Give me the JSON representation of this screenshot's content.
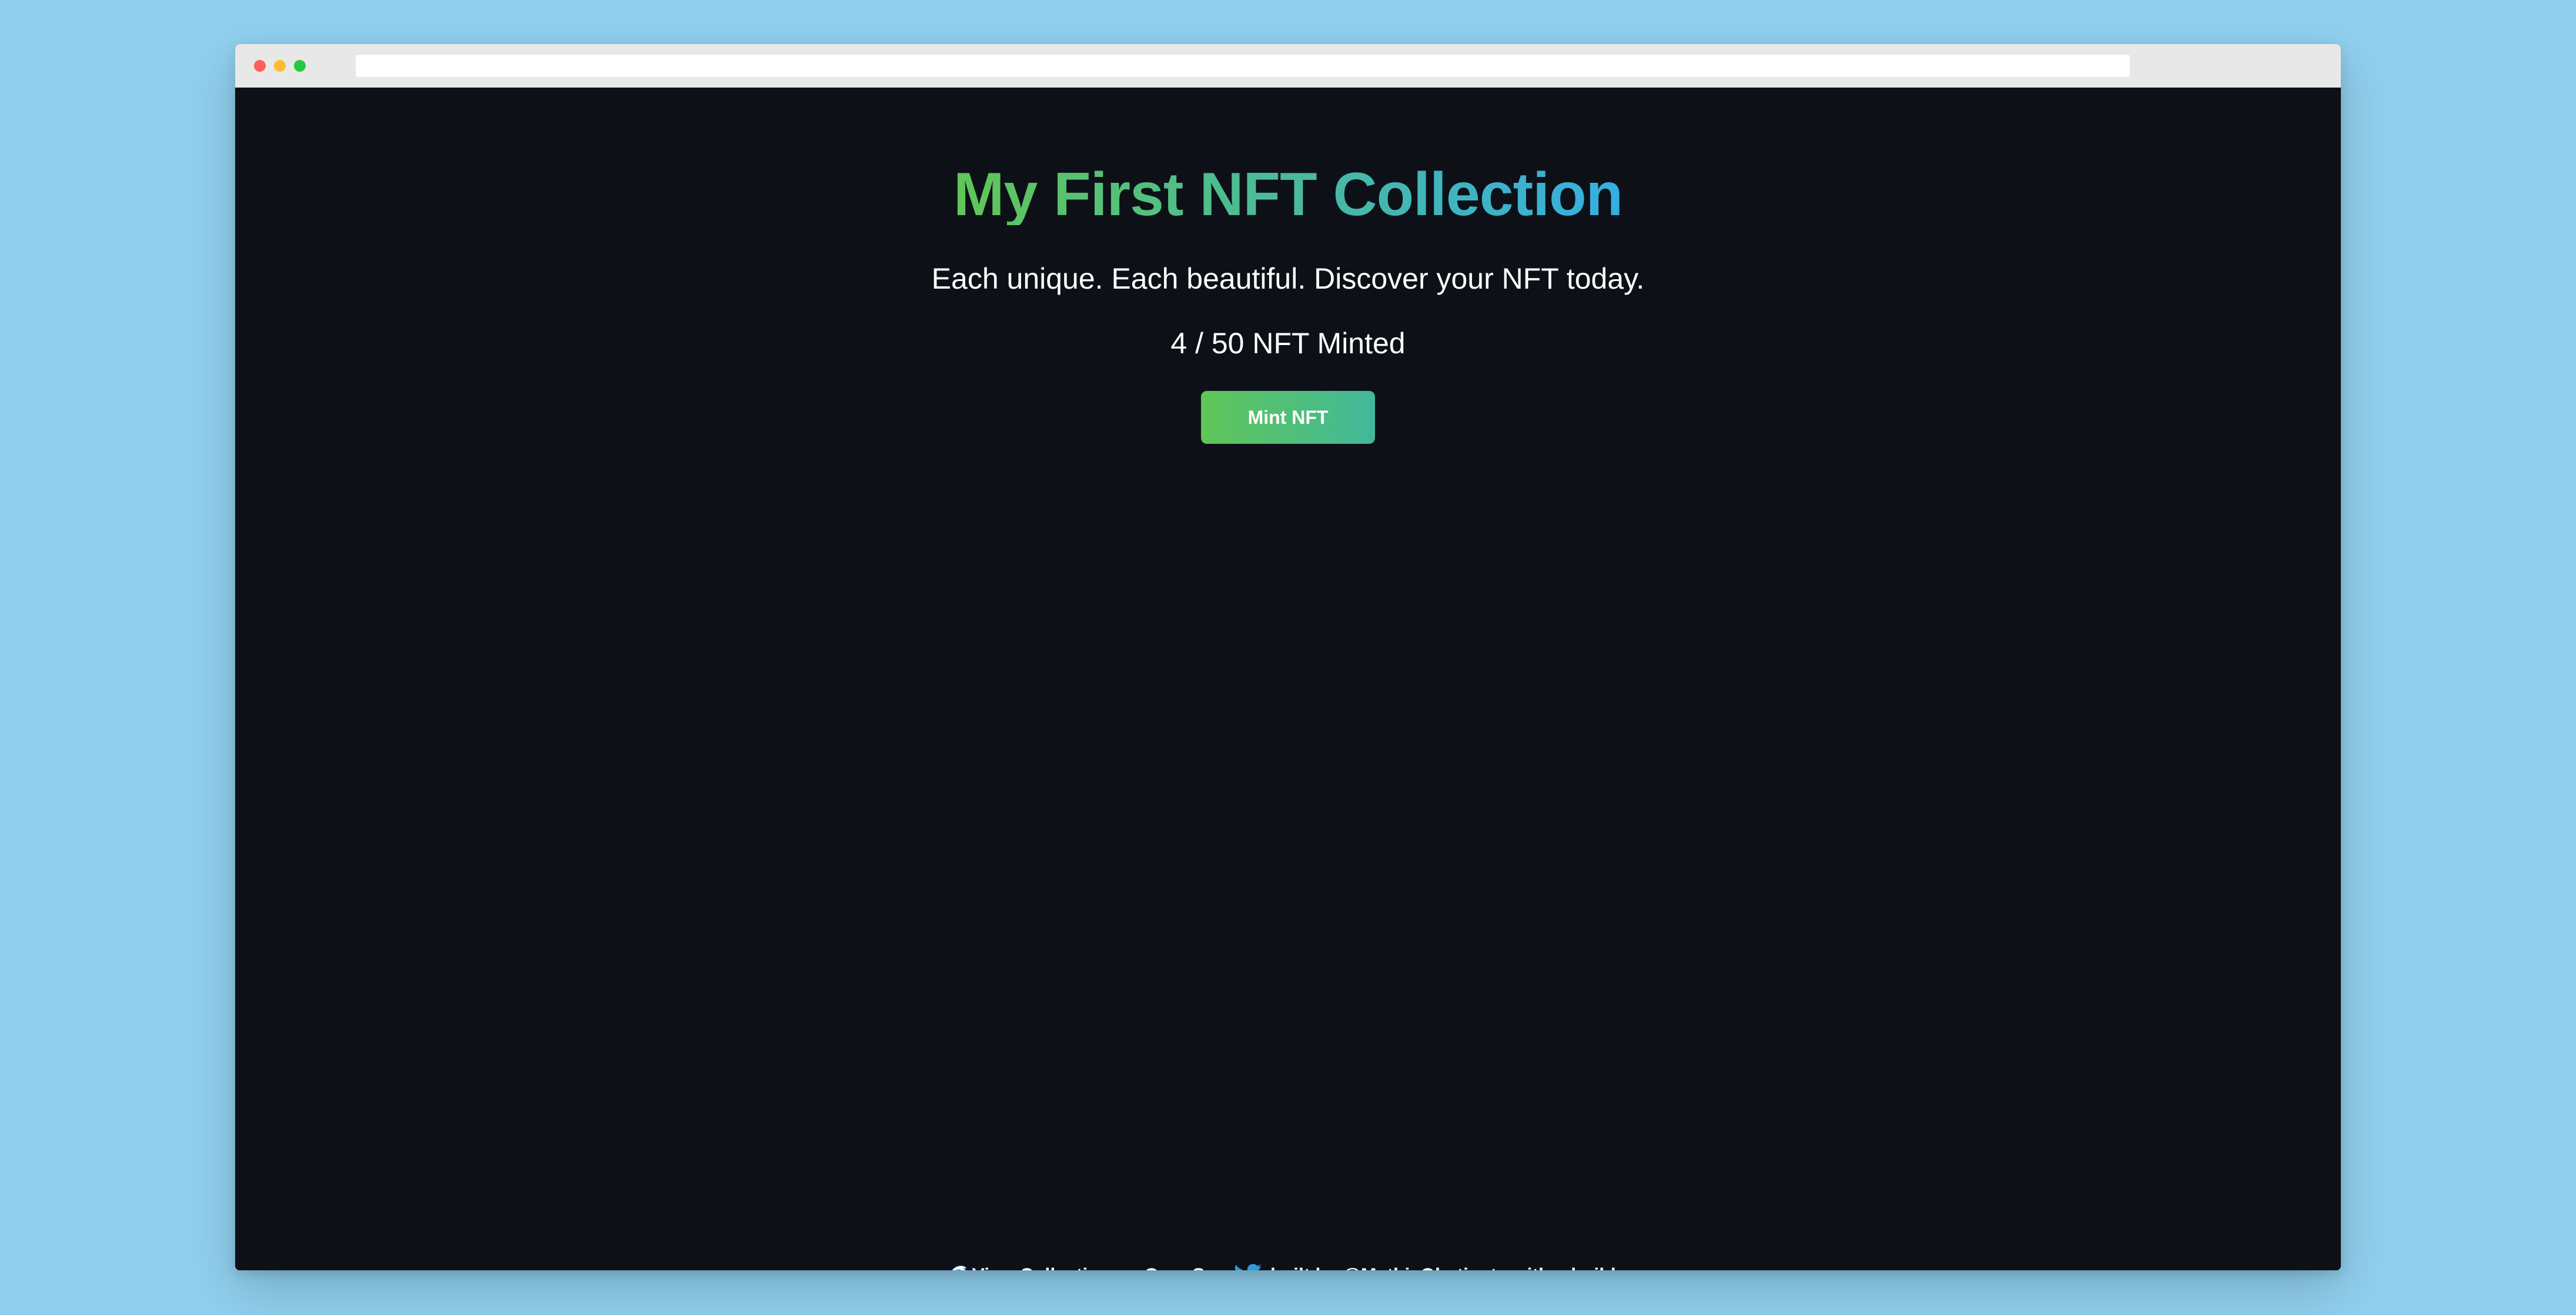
{
  "app": {
    "title": "My First NFT Collection",
    "subtitle": "Each unique. Each beautiful. Discover your NFT today.",
    "minted_count": "4 / 50 NFT Minted",
    "mint_button_label": "Mint NFT"
  },
  "footer": {
    "opensea_link_label": "View Collection on OpenSea",
    "opensea_icon": "wave-icon",
    "twitter_icon": "twitter-bird-icon",
    "built_by_label": "built by @MathisObstinate with  _buildspace"
  },
  "colors": {
    "page_background": "#90cfee",
    "app_background": "#0d1117",
    "gradient_start": "#60c657",
    "gradient_end": "#35aee2",
    "twitter_blue": "#2d9cdb"
  }
}
